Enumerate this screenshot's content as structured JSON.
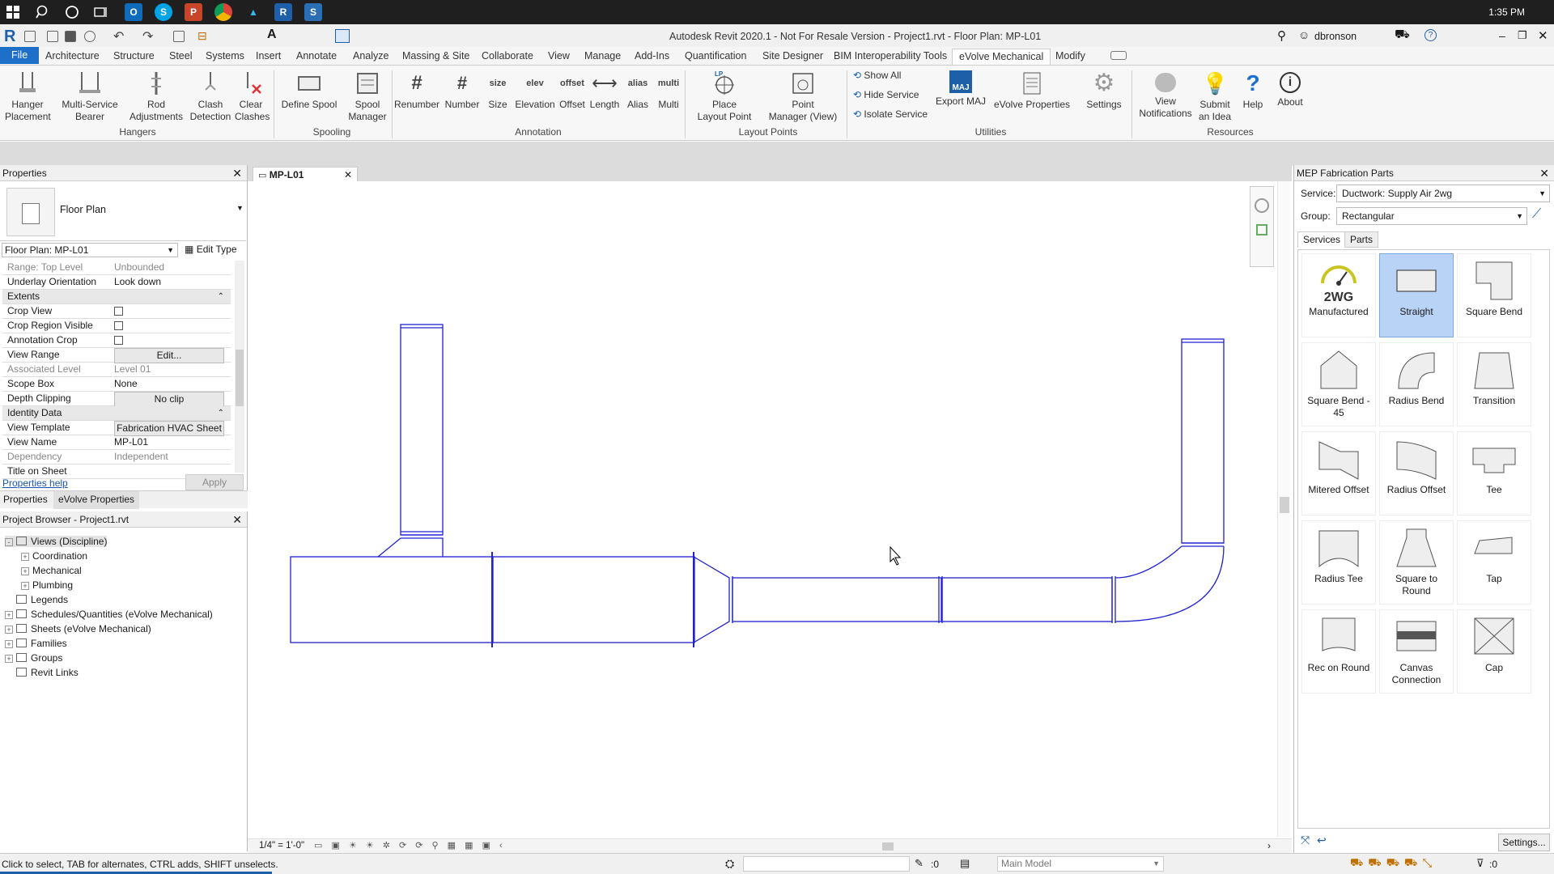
{
  "taskbar": {
    "time": "1:35 PM",
    "icons": [
      "windows-icon",
      "search-icon",
      "cortana-icon",
      "taskview-icon",
      "outlook-icon",
      "skype-icon",
      "powerpoint-icon",
      "chrome-icon",
      "autodesk-icon",
      "revit-icon",
      "s-app-icon"
    ]
  },
  "title": {
    "text": "Autodesk Revit 2020.1 - Not For Resale Version - Project1.rvt - Floor Plan: MP-L01",
    "user": "dbronson"
  },
  "tabs": [
    "File",
    "Architecture",
    "Structure",
    "Steel",
    "Systems",
    "Insert",
    "Annotate",
    "Analyze",
    "Massing & Site",
    "Collaborate",
    "View",
    "Manage",
    "Add-Ins",
    "Quantification",
    "Site Designer",
    "BIM Interoperability Tools",
    "eVolve Mechanical",
    "Modify"
  ],
  "active_tab": "eVolve Mechanical",
  "ribbon": {
    "hangers": {
      "group": "Hangers",
      "buttons": [
        [
          "Hanger",
          "Placement"
        ],
        [
          "Multi-Service",
          "Bearer"
        ],
        [
          "Rod",
          "Adjustments"
        ],
        [
          "Clash",
          "Detection"
        ],
        [
          "Clear",
          "Clashes"
        ]
      ]
    },
    "spooling": {
      "group": "Spooling",
      "buttons": [
        [
          "Define Spool",
          ""
        ],
        [
          "Spool",
          "Manager"
        ]
      ]
    },
    "annotation": {
      "group": "Annotation",
      "buttons": [
        "Renumber",
        "Number",
        "Size",
        "Elevation",
        "Offset",
        "Length",
        "Alias",
        "Multi"
      ],
      "glyphs": [
        "#",
        "#",
        "size",
        "elev",
        "offset",
        "⟷",
        "alias",
        "multi"
      ]
    },
    "layout": {
      "group": "Layout Points",
      "buttons": [
        [
          "Place",
          "Layout Point"
        ],
        [
          "Point",
          "Manager (View)"
        ]
      ],
      "lp": "LP"
    },
    "utilities": {
      "group": "Utilities",
      "small": [
        "Show All",
        "Hide Service",
        "Isolate Service"
      ],
      "buttons": [
        [
          "Export MAJ",
          ""
        ],
        [
          "eVolve Properties",
          ""
        ],
        [
          "Settings",
          ""
        ]
      ],
      "maj": "MAJ"
    },
    "resources": {
      "group": "Resources",
      "buttons": [
        [
          "View",
          "Notifications"
        ],
        [
          "Submit",
          "an Idea"
        ],
        [
          "Help",
          ""
        ],
        [
          "About",
          ""
        ]
      ]
    }
  },
  "properties": {
    "title": "Properties",
    "type": "Floor Plan",
    "instance": "Floor Plan: MP-L01",
    "edit_type": "Edit Type",
    "rows": [
      {
        "k": "Range: Top Level",
        "v": "Unbounded",
        "gray": true
      },
      {
        "k": "Underlay Orientation",
        "v": "Look down"
      },
      {
        "k": "Extents",
        "sec": true
      },
      {
        "k": "Crop View",
        "chk": true
      },
      {
        "k": "Crop Region Visible",
        "chk": true
      },
      {
        "k": "Annotation Crop",
        "chk": true
      },
      {
        "k": "View Range",
        "v": "Edit...",
        "btn": true
      },
      {
        "k": "Associated Level",
        "v": "Level 01",
        "gray": true
      },
      {
        "k": "Scope Box",
        "v": "None"
      },
      {
        "k": "Depth Clipping",
        "v": "No clip",
        "btn": true
      },
      {
        "k": "Identity Data",
        "sec": true
      },
      {
        "k": "View Template",
        "v": "Fabrication HVAC Sheet",
        "btn": true
      },
      {
        "k": "View Name",
        "v": "MP-L01"
      },
      {
        "k": "Dependency",
        "v": "Independent",
        "gray": true
      },
      {
        "k": "Title on Sheet",
        "v": ""
      }
    ],
    "help": "Properties help",
    "apply": "Apply",
    "tabs": [
      "Properties",
      "eVolve Properties"
    ]
  },
  "browser": {
    "title": "Project Browser - Project1.rvt",
    "items": [
      {
        "t": "Views (Discipline)",
        "lvl": 1,
        "exp": "-"
      },
      {
        "t": "Coordination",
        "lvl": 2,
        "exp": "+"
      },
      {
        "t": "Mechanical",
        "lvl": 2,
        "exp": "+"
      },
      {
        "t": "Plumbing",
        "lvl": 2,
        "exp": "+"
      },
      {
        "t": "Legends",
        "lvl": 1,
        "exp": ""
      },
      {
        "t": "Schedules/Quantities (eVolve Mechanical)",
        "lvl": 1,
        "exp": "+"
      },
      {
        "t": "Sheets (eVolve Mechanical)",
        "lvl": 1,
        "exp": "+"
      },
      {
        "t": "Families",
        "lvl": 1,
        "exp": "+"
      },
      {
        "t": "Groups",
        "lvl": 1,
        "exp": "+"
      },
      {
        "t": "Revit Links",
        "lvl": 1,
        "exp": ""
      }
    ]
  },
  "view_tab": "MP-L01",
  "view_scale": "1/4\" = 1'-0\"",
  "status": {
    "hint": "Click to select, TAB for alternates, CTRL adds, SHIFT unselects.",
    "model": "Main Model",
    "count": ":0",
    "filter": ":0"
  },
  "mep": {
    "title": "MEP Fabrication Parts",
    "service_label": "Service:",
    "service": "Ductwork: Supply Air  2wg",
    "group_label": "Group:",
    "group": "Rectangular",
    "tabs": [
      "Services",
      "Parts"
    ],
    "parts": [
      "Manufactured",
      "Straight",
      "Square Bend",
      "Square Bend - 45",
      "Radius Bend",
      "Transition",
      "Mitered Offset",
      "Radius Offset",
      "Tee",
      "Radius Tee",
      "Square to Round",
      "Tap",
      "Rec on Round",
      "Canvas Connection",
      "Cap"
    ],
    "selected": "Straight",
    "badge": "2WG",
    "settings": "Settings..."
  }
}
